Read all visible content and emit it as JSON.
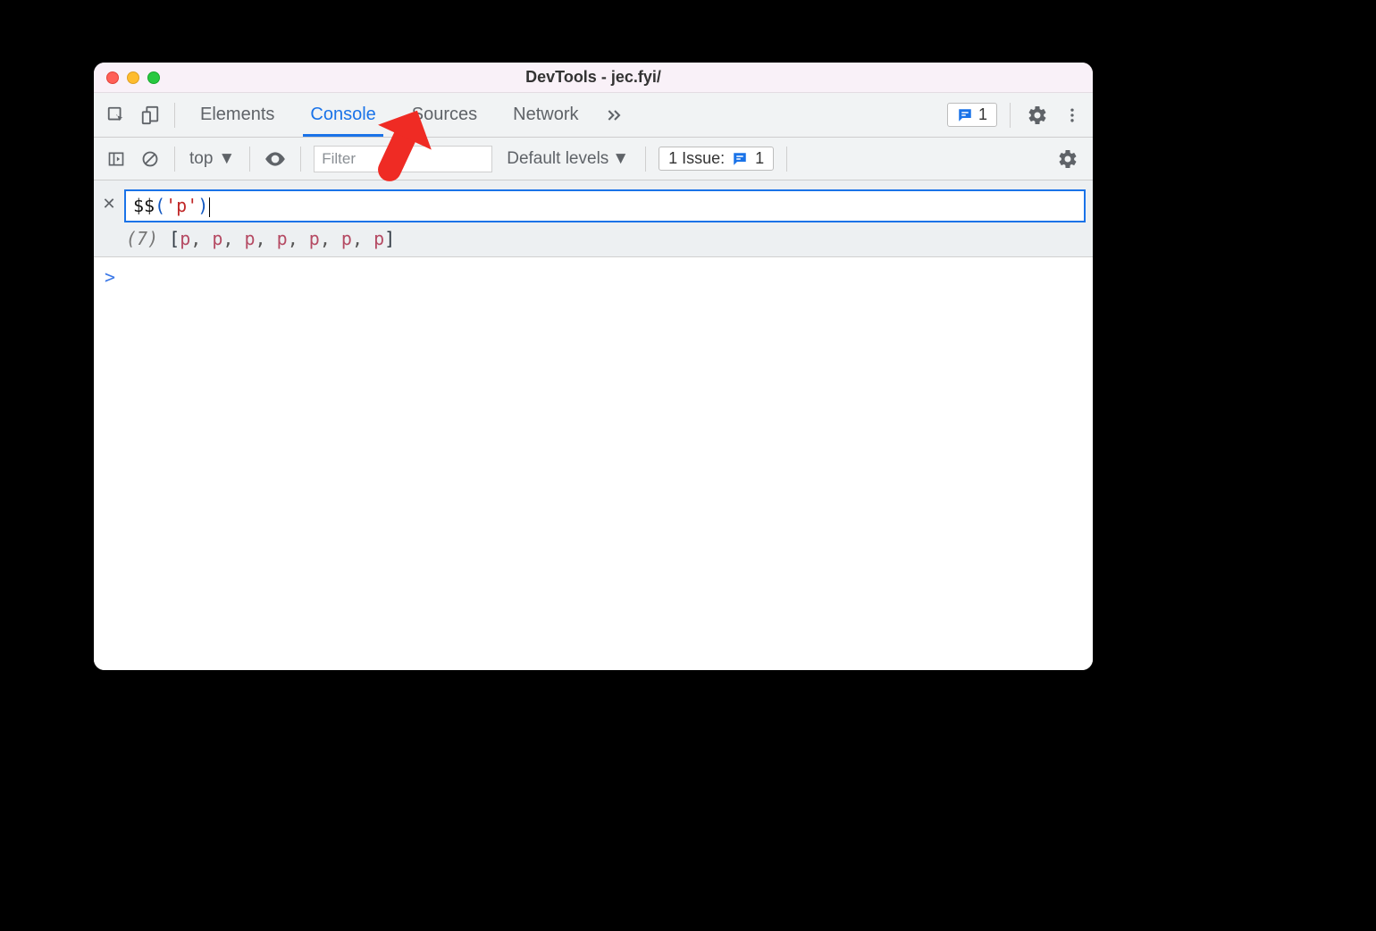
{
  "window": {
    "title": "DevTools - jec.fyi/"
  },
  "toolbar": {
    "tabs": [
      {
        "label": "Elements"
      },
      {
        "label": "Console"
      },
      {
        "label": "Sources"
      },
      {
        "label": "Network"
      }
    ],
    "feedback_count": "1"
  },
  "filterbar": {
    "context": "top",
    "filter_placeholder": "Filter",
    "levels_label": "Default levels",
    "issues_label": "1 Issue:",
    "issues_count": "1"
  },
  "live_expression": {
    "input_fn": "$$",
    "input_open": "(",
    "input_str": "'p'",
    "input_close": ")",
    "result_count": "(7)",
    "result_open": "[",
    "result_elems": [
      "p",
      "p",
      "p",
      "p",
      "p",
      "p",
      "p"
    ],
    "result_close": "]"
  },
  "prompt": {
    "caret": ">"
  }
}
